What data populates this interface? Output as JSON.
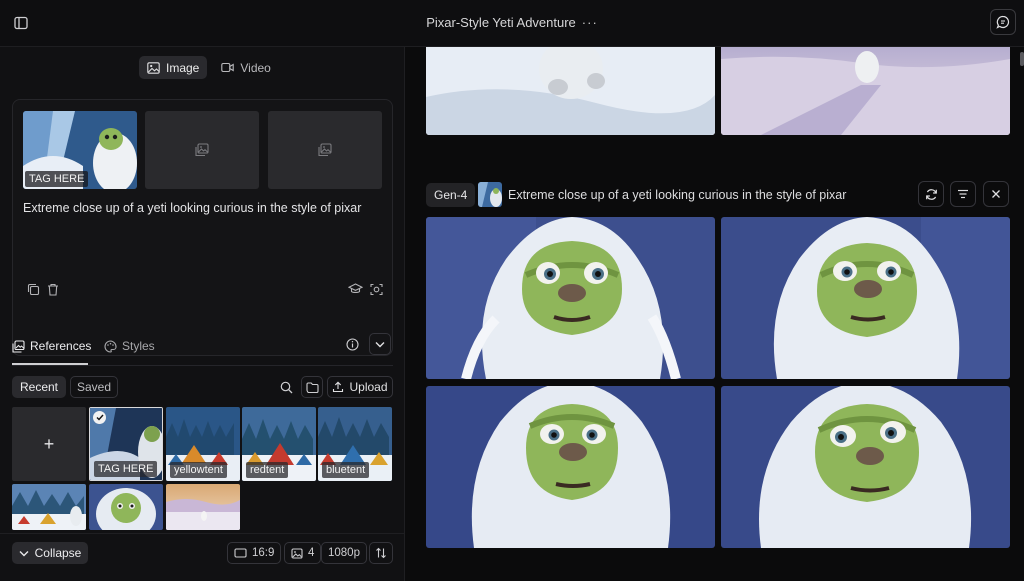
{
  "header": {
    "title": "Pixar-Style Yeti Adventure",
    "more": "···"
  },
  "mode_tabs": [
    {
      "label": "Image",
      "icon": "image-icon",
      "active": true
    },
    {
      "label": "Video",
      "icon": "video-icon",
      "active": false
    }
  ],
  "prompt_card": {
    "slot1_tag": "TAG HERE",
    "prompt": "Extreme close up of a yeti looking curious in the style of pixar"
  },
  "ref_tabs": [
    {
      "label": "References",
      "icon": "references-icon",
      "active": true
    },
    {
      "label": "Styles",
      "icon": "palette-icon",
      "active": false
    }
  ],
  "ref_filters": {
    "recent": "Recent",
    "saved": "Saved",
    "upload": "Upload"
  },
  "references": {
    "add": "+",
    "items": [
      {
        "label": "TAG HERE",
        "selected": true
      },
      {
        "label": "yellowtent"
      },
      {
        "label": "redtent"
      },
      {
        "label": "bluetent"
      }
    ]
  },
  "footer": {
    "collapse": "Collapse",
    "aspect": "16:9",
    "count": "4",
    "resolution": "1080p"
  },
  "generation": {
    "model": "Gen-4",
    "prompt": "Extreme close up of a yeti looking curious in the style of pixar"
  },
  "colors": {
    "snow_sky": "#dfe7f2",
    "yeti_bg": "#3d4f8e",
    "yeti_face": "#8fb65a"
  }
}
